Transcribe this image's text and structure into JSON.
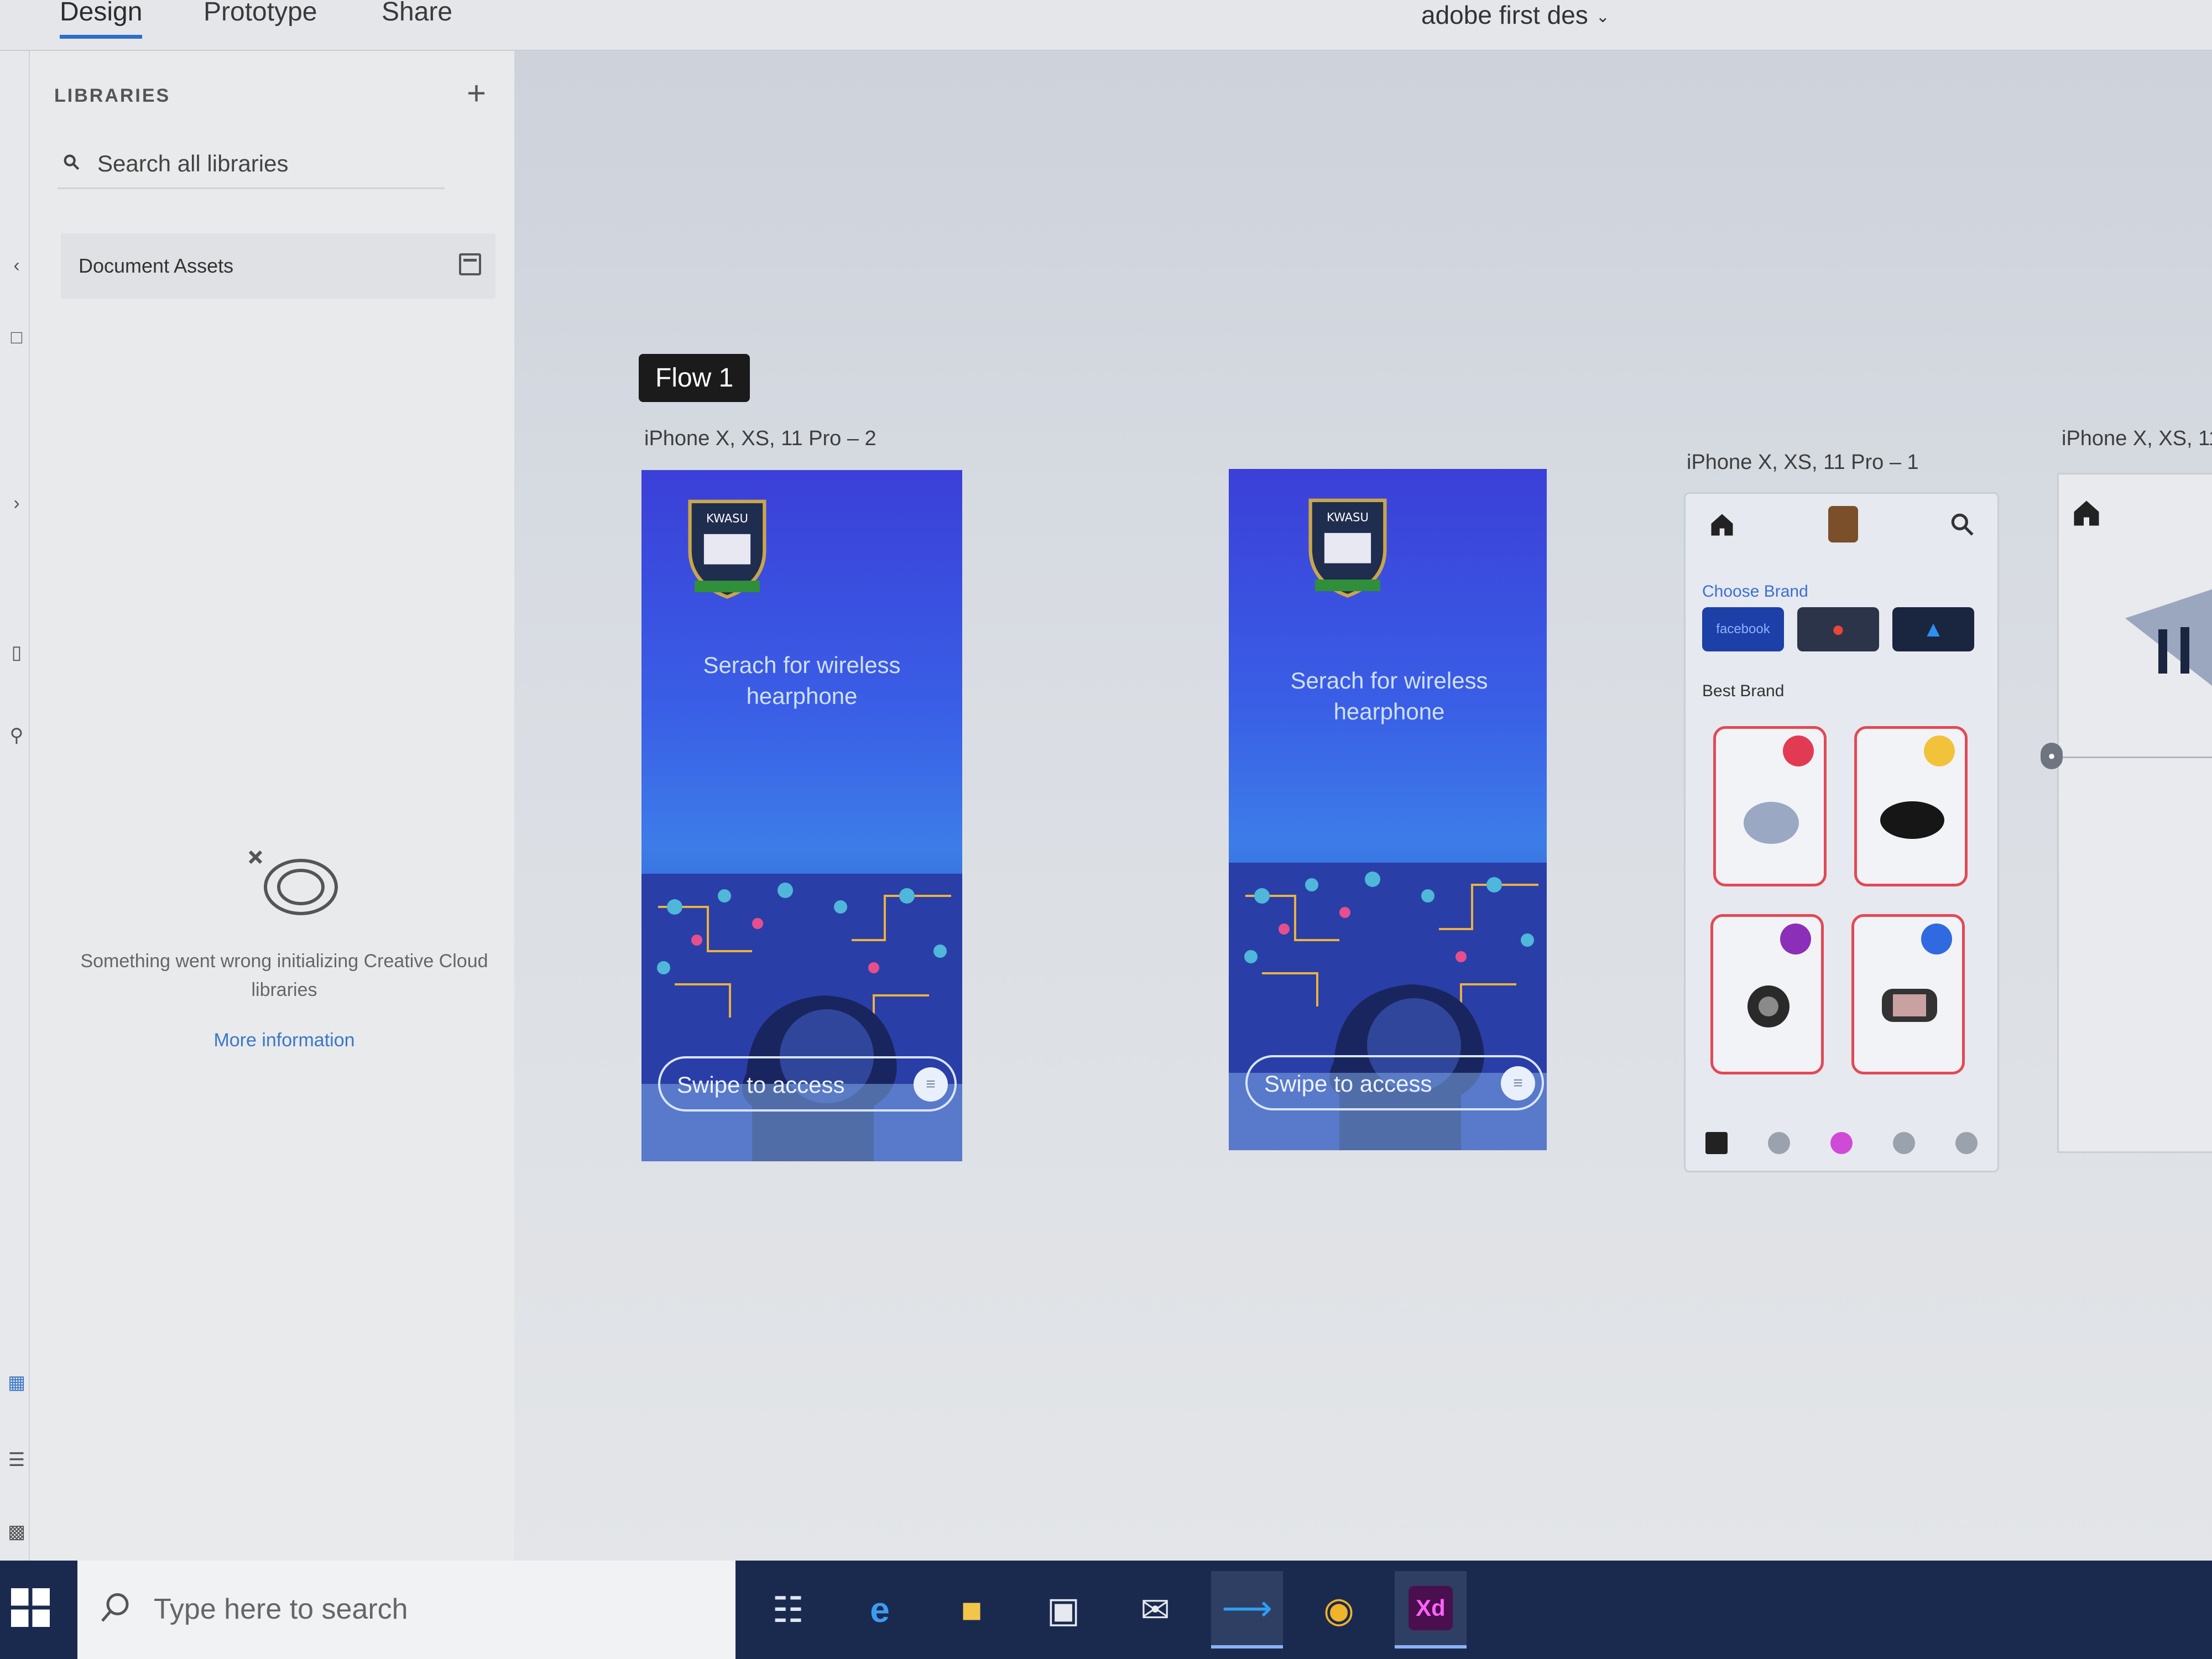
{
  "topbar": {
    "tabs": [
      "Design",
      "Prototype",
      "Share"
    ],
    "doc_title": "adobe first des"
  },
  "libraries": {
    "title": "LIBRARIES",
    "search_placeholder": "Search all libraries",
    "document_assets": "Document Assets",
    "error_message": "Something went wrong initializing Creative Cloud libraries",
    "more_info": "More information"
  },
  "canvas": {
    "flow_tag": "Flow 1",
    "artboards": [
      {
        "label": "iPhone X, XS, 11 Pro – 2",
        "crest_text": "KWASU",
        "tagline": "Serach for wireless hearphone",
        "swipe": "Swipe to access"
      },
      {
        "label": "",
        "crest_text": "KWASU",
        "tagline": "Serach for wireless hearphone",
        "swipe": "Swipe to access"
      },
      {
        "label": "iPhone X, XS, 11 Pro – 1",
        "choose_brand": "Choose Brand",
        "best_brand": "Best Brand",
        "brands": [
          "facebook",
          "",
          ""
        ]
      },
      {
        "label": "iPhone X, XS, 11"
      }
    ]
  },
  "taskbar": {
    "search_placeholder": "Type here to search",
    "apps": [
      "task-view",
      "edge",
      "file-explorer",
      "store",
      "mail",
      "vscode",
      "chrome",
      "adobe-xd"
    ],
    "xd_label": "Xd"
  },
  "colors": {
    "accent": "#2d6ec6",
    "splash_blue": "#3a5fe6",
    "card_border": "#e14a55",
    "taskbar": "#1a2a4f"
  }
}
